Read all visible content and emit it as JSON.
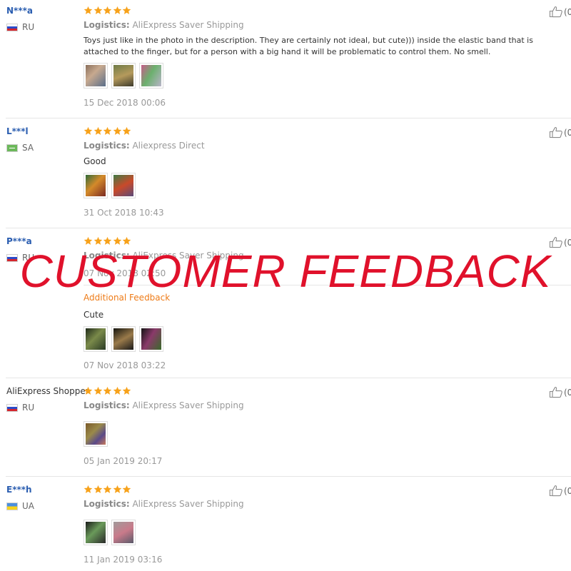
{
  "overlay_text": "CUSTOMER FEEDBACK",
  "accent_color": "#ee7b17",
  "star_color": "#f7a21b",
  "reviews": [
    {
      "user": "N***a",
      "country": "RU",
      "rating": 5,
      "logistics_label": "Logistics:",
      "logistics_value": "AliExpress Saver Shipping",
      "text": "Toys just like in the photo in the description. They are certainly not ideal, but cute))) inside the elastic band that is attached to the finger, but for a person with a big hand it will be problematic to control them. No smell.",
      "photo_count": 3,
      "date": "15 Dec 2018 00:06",
      "likes": "(0"
    },
    {
      "user": "L***l",
      "country": "SA",
      "rating": 5,
      "logistics_label": "Logistics:",
      "logistics_value": "Aliexpress Direct",
      "text": "Good",
      "photo_count": 2,
      "date": "31 Oct 2018 10:43",
      "likes": "(0"
    },
    {
      "user": "P***a",
      "country": "RU",
      "rating": 5,
      "logistics_label": "Logistics:",
      "logistics_value": "AliExpress Saver Shipping",
      "date": "07 Nov 2018 02:50",
      "additional_label": "Additional Feedback",
      "additional_text": "Cute",
      "photo_count": 3,
      "additional_date": "07 Nov 2018 03:22",
      "likes": "(0"
    },
    {
      "user": "AliExpress Shopper",
      "country": "RU",
      "rating": 5,
      "logistics_label": "Logistics:",
      "logistics_value": "AliExpress Saver Shipping",
      "photo_count": 1,
      "date": "05 Jan 2019 20:17",
      "likes": "(0"
    },
    {
      "user": "E***h",
      "country": "UA",
      "rating": 5,
      "logistics_label": "Logistics:",
      "logistics_value": "AliExpress Saver Shipping",
      "photo_count": 2,
      "date": "11 Jan 2019 03:16",
      "likes": "(0"
    }
  ]
}
